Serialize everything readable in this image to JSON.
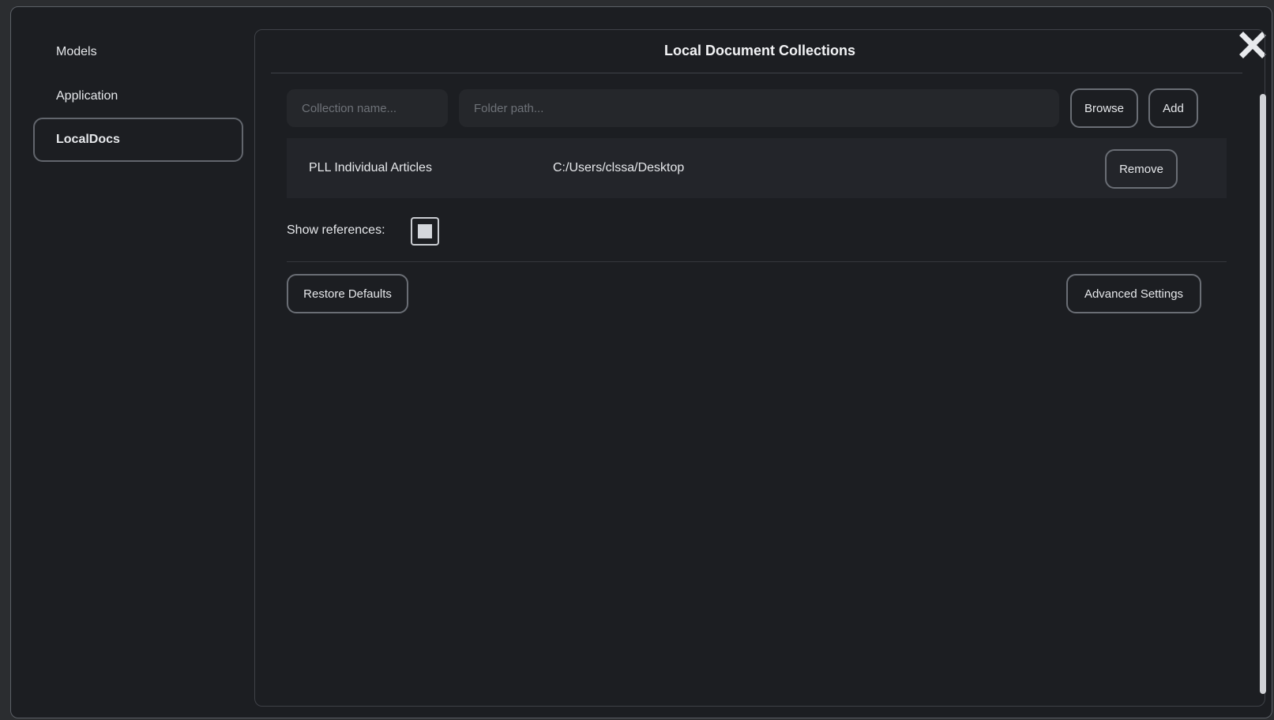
{
  "nav": {
    "items": [
      {
        "label": "Models"
      },
      {
        "label": "Application"
      },
      {
        "label": "LocalDocs"
      }
    ],
    "active_index": 2
  },
  "panel": {
    "title": "Local Document Collections"
  },
  "add_form": {
    "name_placeholder": "Collection name...",
    "name_value": "",
    "path_placeholder": "Folder path...",
    "path_value": "",
    "browse_label": "Browse",
    "add_label": "Add"
  },
  "collections": [
    {
      "name": "PLL Individual Articles",
      "path": "C:/Users/clssa/Desktop",
      "remove_label": "Remove"
    }
  ],
  "show_references": {
    "label": "Show references:",
    "checked": true
  },
  "footer": {
    "restore_label": "Restore Defaults",
    "advanced_label": "Advanced Settings"
  },
  "icons": {
    "close": "close-icon"
  },
  "colors": {
    "background": "#1c1e22",
    "border": "#62666d",
    "text": "#e6e8eb"
  }
}
